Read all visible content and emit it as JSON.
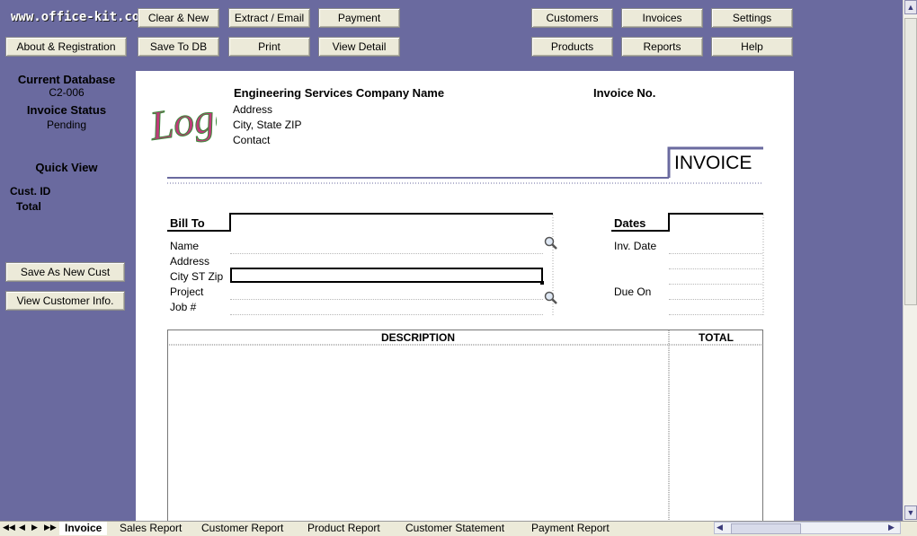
{
  "brand": "www.office-kit.com",
  "toolbar": {
    "clear_new": "Clear & New",
    "extract_email": "Extract / Email",
    "payment": "Payment",
    "customers": "Customers",
    "invoices": "Invoices",
    "settings": "Settings",
    "about": "About & Registration",
    "save_db": "Save To DB",
    "print": "Print",
    "view_detail": "View Detail",
    "products": "Products",
    "reports": "Reports",
    "help": "Help"
  },
  "sidebar": {
    "current_db_label": "Current Database",
    "current_db_value": "C2-006",
    "status_label": "Invoice Status",
    "status_value": "Pending",
    "quick_view": "Quick  View",
    "cust_id": "Cust. ID",
    "total": "Total",
    "save_new_cust": "Save As New Cust",
    "view_cust_info": "View Customer Info."
  },
  "invoice": {
    "logo": "Logo",
    "company": "Engineering Services Company Name",
    "address": "Address",
    "city": "City, State ZIP",
    "contact": "Contact",
    "invoice_no": "Invoice No.",
    "title": "INVOICE",
    "bill_to": "Bill To",
    "name": "Name",
    "addr": "Address",
    "city_st_zip": "City ST Zip",
    "project": "Project",
    "job": "Job #",
    "dates": "Dates",
    "inv_date": "Inv. Date",
    "due_on": "Due On",
    "col_desc": "DESCRIPTION",
    "col_total": "TOTAL"
  },
  "tabs": [
    "Invoice",
    "Sales Report",
    "Customer Report",
    "Product Report",
    "Customer Statement",
    "Payment Report"
  ],
  "colors": {
    "background": "#6a6a9f",
    "accent": "#6a6a9f"
  }
}
